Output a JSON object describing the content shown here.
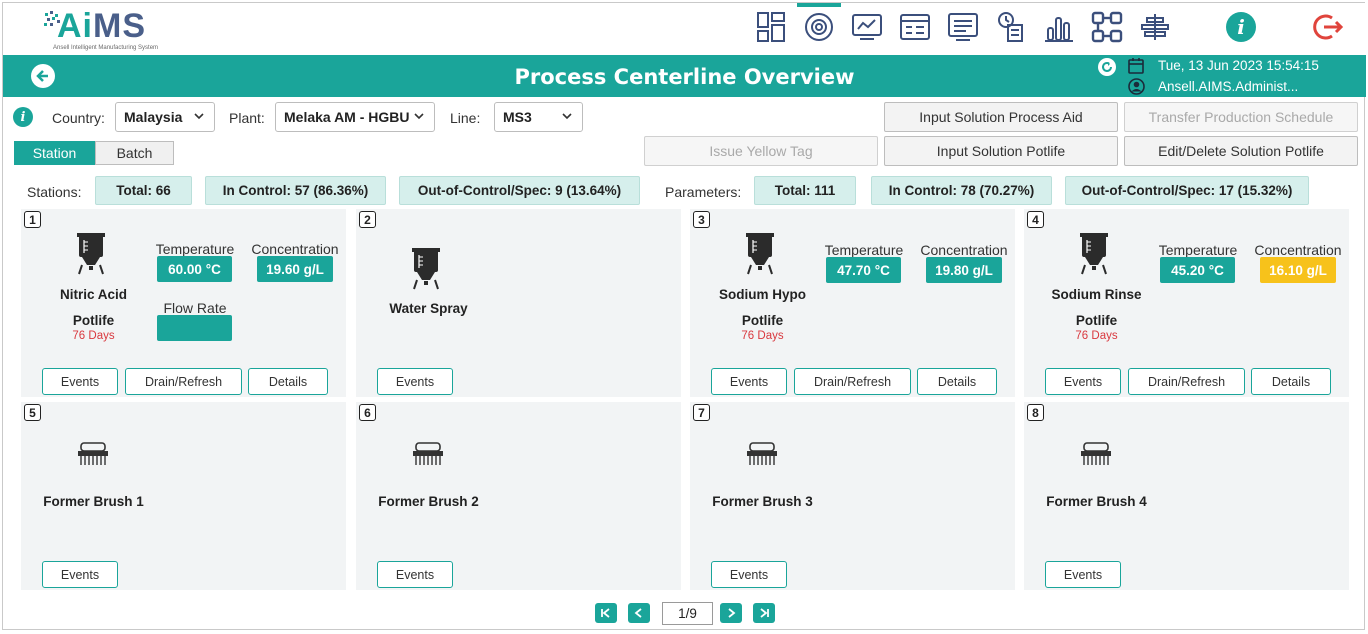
{
  "app": {
    "logo_text_ai": "Ai",
    "logo_text_ms": "MS",
    "logo_subtitle": "Ansell Intelligent Manufacturing System"
  },
  "nav": {
    "icons": [
      "dashboard-grid-icon",
      "gear-icon",
      "line-chart-icon",
      "table-icon",
      "list-icon",
      "document-clock-icon",
      "bar-chart-icon",
      "hierarchy-icon",
      "layers-icon",
      "info-icon",
      "logout-icon"
    ]
  },
  "header": {
    "title": "Process Centerline Overview",
    "datetime": "Tue, 13 Jun 2023 15:54:15",
    "user": "Ansell.AIMS.Administ..."
  },
  "filters": {
    "country_label": "Country:",
    "country_value": "Malaysia",
    "plant_label": "Plant:",
    "plant_value": "Melaka AM - HGBU",
    "line_label": "Line:",
    "line_value": "MS3"
  },
  "actions": {
    "input_solution_process_aid": "Input Solution Process Aid",
    "transfer_production_schedule": "Transfer Production Schedule",
    "issue_yellow_tag": "Issue Yellow Tag",
    "input_solution_potlife": "Input Solution Potlife",
    "edit_delete_solution_potlife": "Edit/Delete Solution Potlife"
  },
  "tabs": [
    {
      "label": "Station",
      "active": true
    },
    {
      "label": "Batch",
      "active": false
    }
  ],
  "summary": {
    "stations_label": "Stations:",
    "stations_total": "Total: 66",
    "stations_in_control": "In Control: 57 (86.36%)",
    "stations_out": "Out-of-Control/Spec: 9 (13.64%)",
    "parameters_label": "Parameters:",
    "parameters_total": "Total: 111",
    "parameters_in_control": "In Control: 78 (70.27%)",
    "parameters_out": "Out-of-Control/Spec: 17 (15.32%)"
  },
  "cards": [
    {
      "num": "1",
      "name": "Nitric Acid",
      "potlife_label": "Potlife",
      "days": "76 Days",
      "temp_label": "Temperature",
      "temp": "60.00 °C",
      "conc_label": "Concentration",
      "conc": "19.60 g/L",
      "flow_label": "Flow Rate",
      "events": "Events",
      "drain": "Drain/Refresh",
      "details": "Details"
    },
    {
      "num": "2",
      "name": "Water Spray",
      "events": "Events"
    },
    {
      "num": "3",
      "name": "Sodium Hypo",
      "potlife_label": "Potlife",
      "days": "76 Days",
      "temp_label": "Temperature",
      "temp": "47.70 °C",
      "conc_label": "Concentration",
      "conc": "19.80 g/L",
      "events": "Events",
      "drain": "Drain/Refresh",
      "details": "Details"
    },
    {
      "num": "4",
      "name": "Sodium Rinse",
      "potlife_label": "Potlife",
      "days": "76 Days",
      "temp_label": "Temperature",
      "temp": "45.20 °C",
      "conc_label": "Concentration",
      "conc": "16.10 g/L",
      "events": "Events",
      "drain": "Drain/Refresh",
      "details": "Details"
    },
    {
      "num": "5",
      "name": "Former Brush 1",
      "events": "Events"
    },
    {
      "num": "6",
      "name": "Former Brush 2",
      "events": "Events"
    },
    {
      "num": "7",
      "name": "Former Brush 3",
      "events": "Events"
    },
    {
      "num": "8",
      "name": "Former Brush 4",
      "events": "Events"
    }
  ],
  "colors": {
    "teal": "#1aa59a",
    "warning": "#f7c21b",
    "days_red": "#d9393f"
  },
  "pager": {
    "text": "1/9"
  }
}
